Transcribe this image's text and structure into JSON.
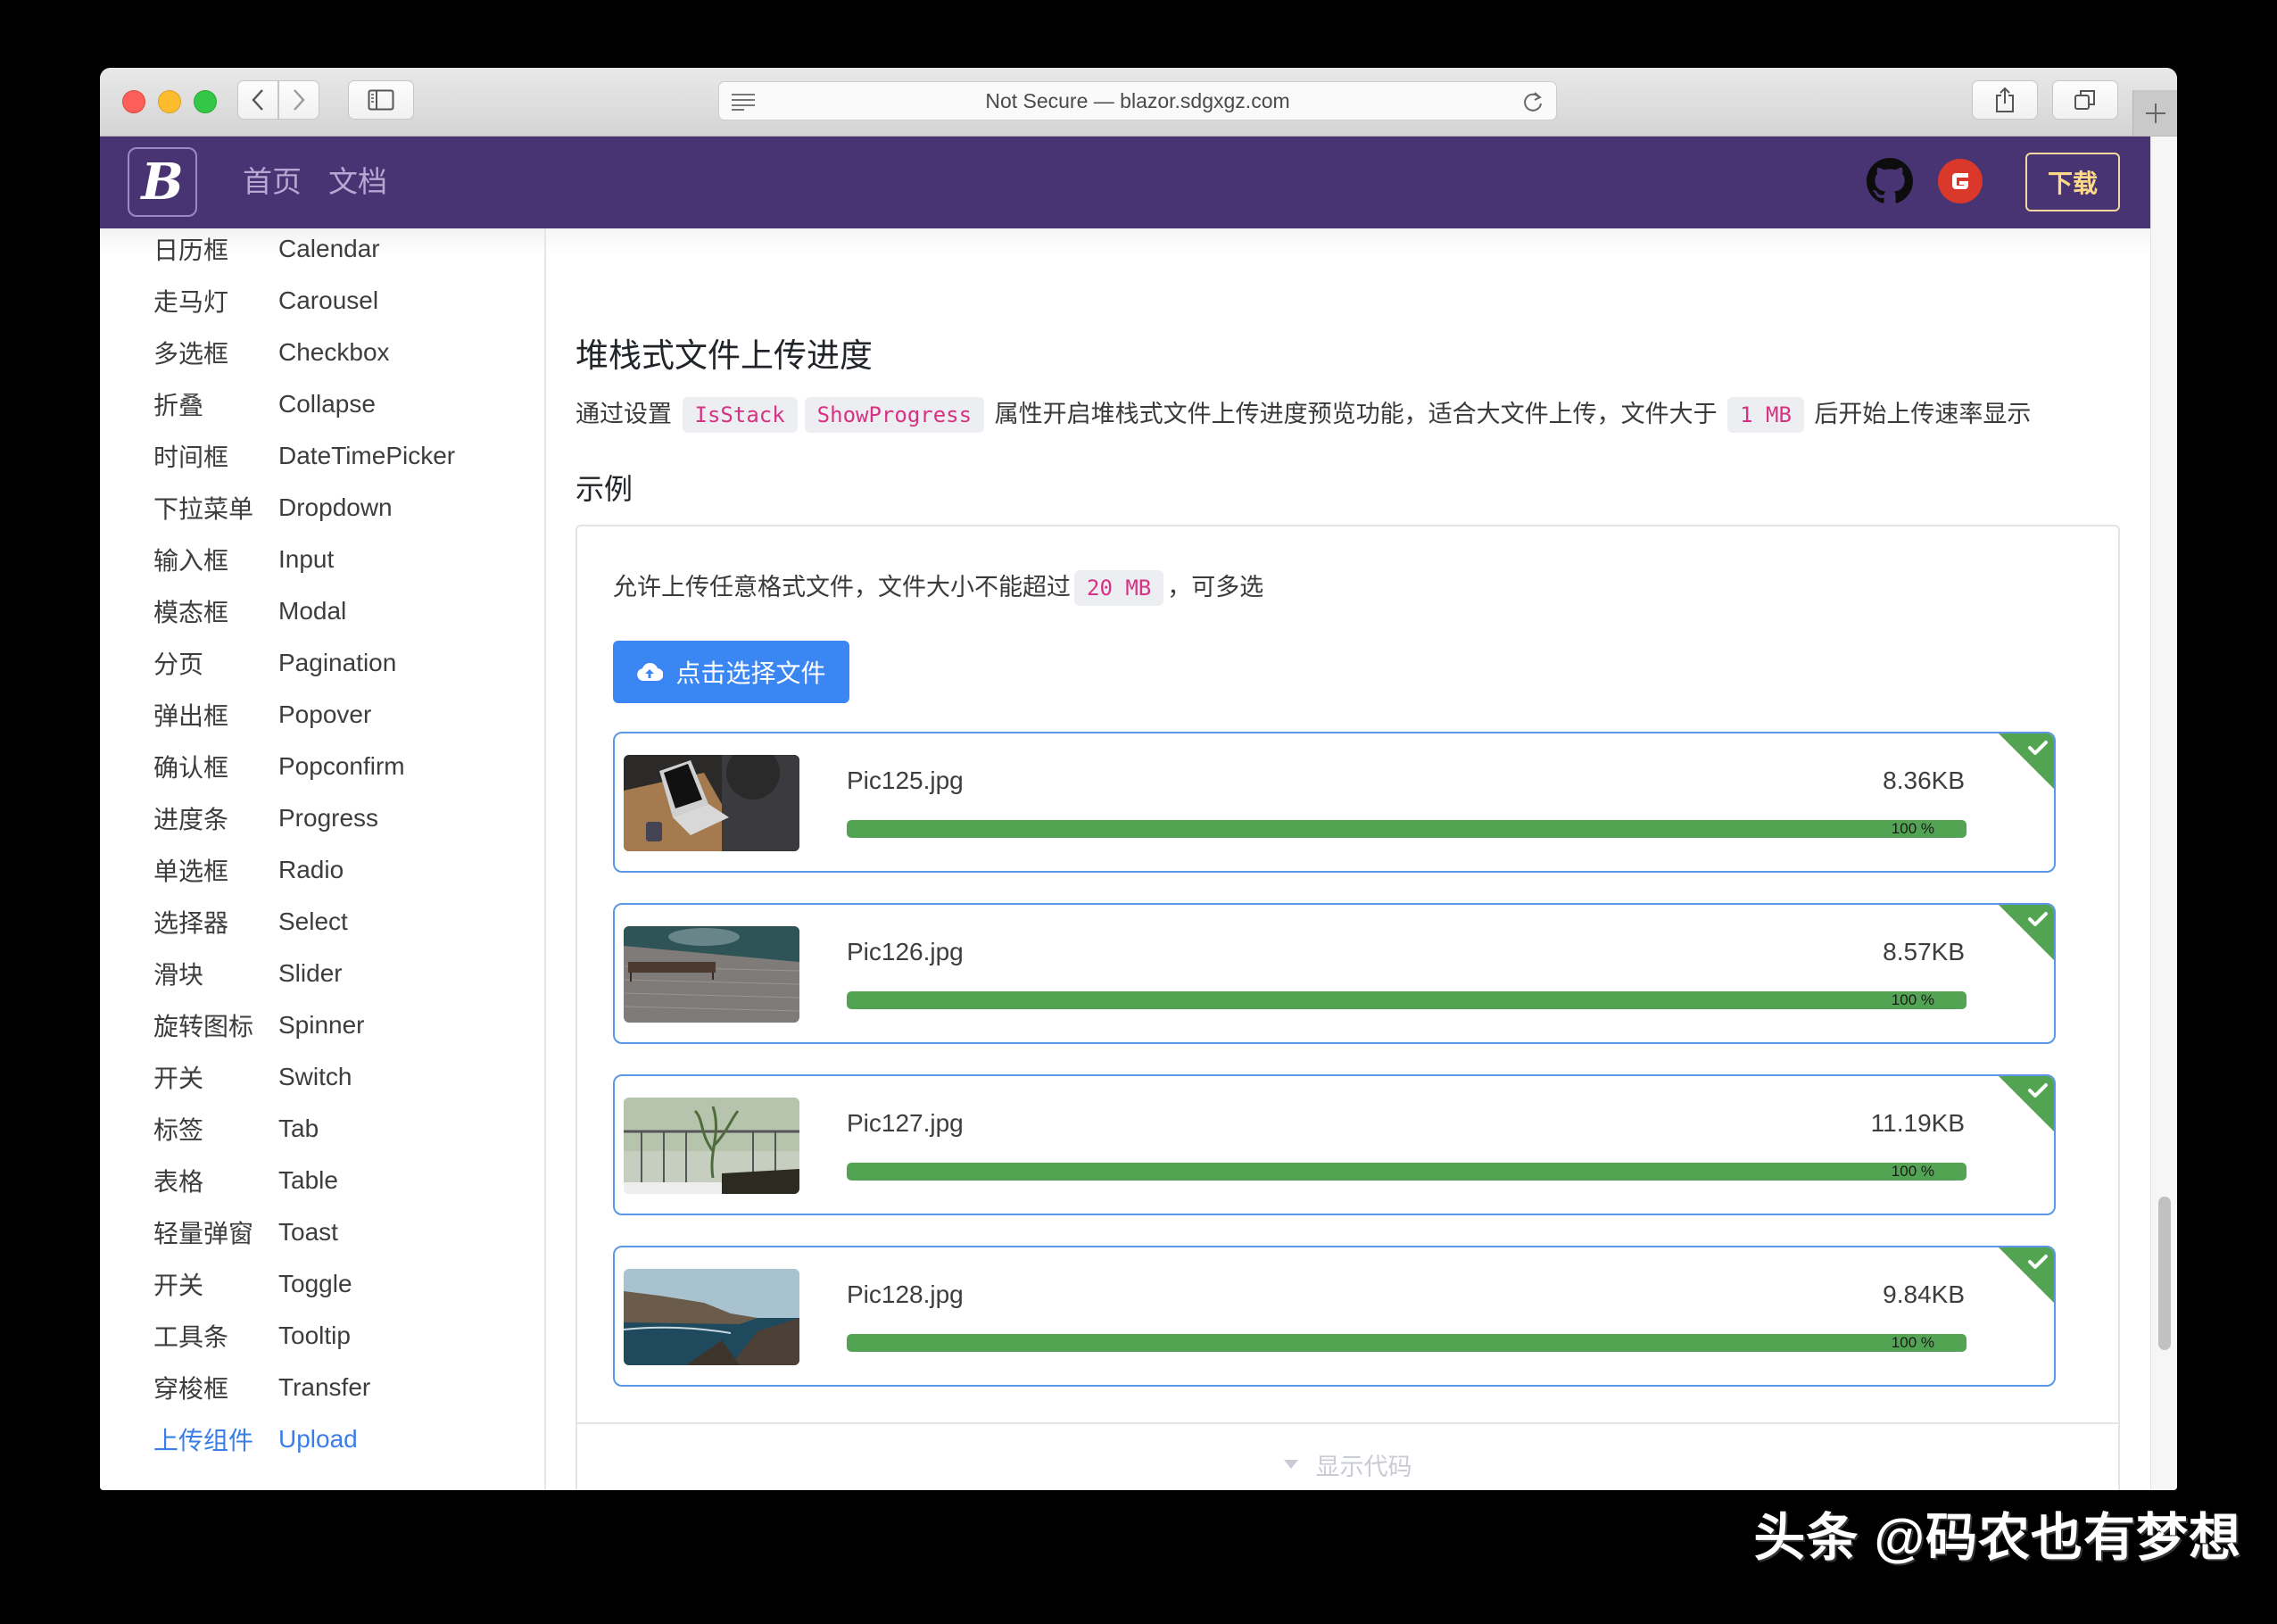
{
  "browser": {
    "url_text": "Not Secure — blazor.sdgxgz.com",
    "icons": [
      "back-icon",
      "forward-icon",
      "sidebar-toggle-icon",
      "reader-icon",
      "reload-icon",
      "share-icon",
      "tabs-icon",
      "new-tab-icon"
    ]
  },
  "header": {
    "logo_letter": "B",
    "nav": [
      {
        "label": "首页"
      },
      {
        "label": "文档"
      }
    ],
    "github_icon": "github-icon",
    "gitee_icon": "gitee-icon",
    "download_label": "下载",
    "colors": {
      "bar": "#483473",
      "nav_text": "#b6a8d3",
      "download": "#ffd98a"
    }
  },
  "sidebar": {
    "items": [
      {
        "cn": "日历框",
        "en": "Calendar"
      },
      {
        "cn": "走马灯",
        "en": "Carousel"
      },
      {
        "cn": "多选框",
        "en": "Checkbox"
      },
      {
        "cn": "折叠",
        "en": "Collapse"
      },
      {
        "cn": "时间框",
        "en": "DateTimePicker"
      },
      {
        "cn": "下拉菜单",
        "en": "Dropdown"
      },
      {
        "cn": "输入框",
        "en": "Input"
      },
      {
        "cn": "模态框",
        "en": "Modal"
      },
      {
        "cn": "分页",
        "en": "Pagination"
      },
      {
        "cn": "弹出框",
        "en": "Popover"
      },
      {
        "cn": "确认框",
        "en": "Popconfirm"
      },
      {
        "cn": "进度条",
        "en": "Progress"
      },
      {
        "cn": "单选框",
        "en": "Radio"
      },
      {
        "cn": "选择器",
        "en": "Select"
      },
      {
        "cn": "滑块",
        "en": "Slider"
      },
      {
        "cn": "旋转图标",
        "en": "Spinner"
      },
      {
        "cn": "开关",
        "en": "Switch"
      },
      {
        "cn": "标签",
        "en": "Tab"
      },
      {
        "cn": "表格",
        "en": "Table"
      },
      {
        "cn": "轻量弹窗",
        "en": "Toast"
      },
      {
        "cn": "开关",
        "en": "Toggle"
      },
      {
        "cn": "工具条",
        "en": "Tooltip"
      },
      {
        "cn": "穿梭框",
        "en": "Transfer"
      },
      {
        "cn": "上传组件",
        "en": "Upload",
        "active": true
      }
    ],
    "active_color": "#3a7ee6"
  },
  "main": {
    "title": "堆栈式文件上传进度",
    "desc": {
      "prefix": "通过设置",
      "code1": "IsStack",
      "code2": "ShowProgress",
      "middle": "属性开启堆栈式文件上传进度预览功能，适合大文件上传，文件大于",
      "code3": "1 MB",
      "suffix": "后开始上传速率显示"
    },
    "example_label": "示例",
    "card": {
      "intro_prefix": "允许上传任意格式文件，文件大小不能超过",
      "intro_code": "20 MB",
      "intro_suffix": "，可多选",
      "button_label": "点击选择文件",
      "button_icon": "cloud-upload-icon",
      "files": [
        {
          "name": "Pic125.jpg",
          "size": "8.36KB",
          "progress": 100,
          "progress_label": "100 %",
          "status": "success",
          "thumb": "laptop-photo"
        },
        {
          "name": "Pic126.jpg",
          "size": "8.57KB",
          "progress": 100,
          "progress_label": "100 %",
          "status": "success",
          "thumb": "bench-pier-photo"
        },
        {
          "name": "Pic127.jpg",
          "size": "11.19KB",
          "progress": 100,
          "progress_label": "100 %",
          "status": "success",
          "thumb": "balcony-plant-photo"
        },
        {
          "name": "Pic128.jpg",
          "size": "9.84KB",
          "progress": 100,
          "progress_label": "100 %",
          "status": "success",
          "thumb": "coast-photo"
        }
      ],
      "footer_label": "显示代码"
    },
    "colors": {
      "button": "#3a86f3",
      "progress": "#52a352",
      "item_border": "#5b97e6",
      "code_text": "#d63384"
    }
  },
  "watermark": "头条 @码农也有梦想"
}
